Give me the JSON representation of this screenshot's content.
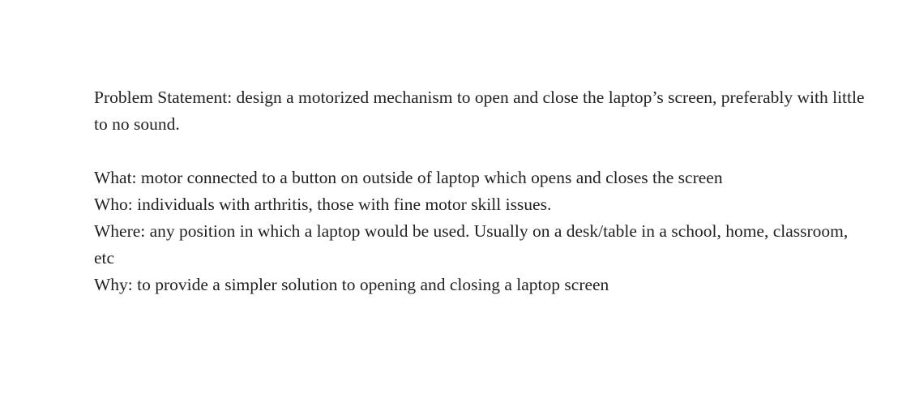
{
  "document": {
    "problem_statement": "Problem Statement: design a motorized mechanism to open and close the laptop’s screen, preferably with little to no sound.",
    "what": "What: motor connected to a button on outside of laptop which opens and closes the screen",
    "who": "Who: individuals with arthritis, those with fine motor skill issues.",
    "where": "Where: any position in which a laptop would be used. Usually on a desk/table in a school, home, classroom, etc",
    "why": "Why: to provide a simpler solution to opening and closing a laptop screen"
  }
}
